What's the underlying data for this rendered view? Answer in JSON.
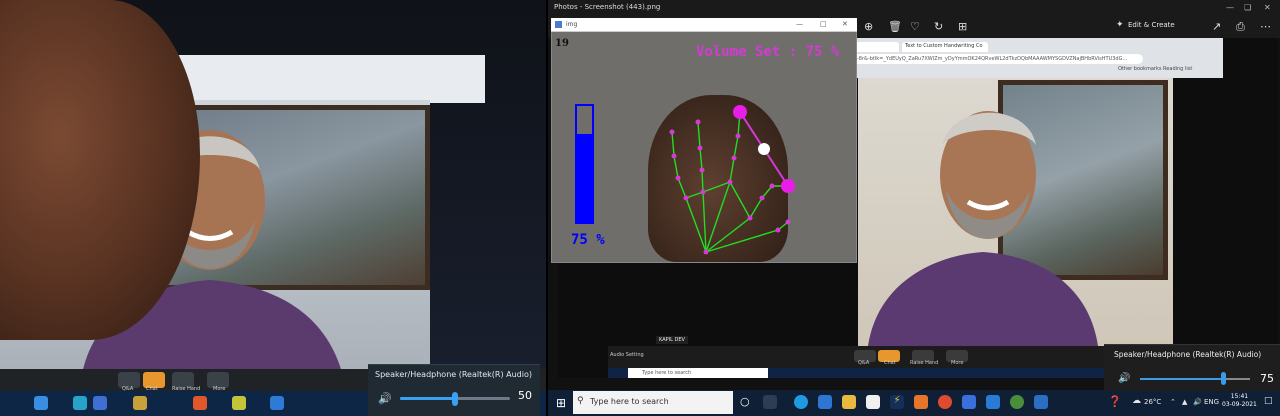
{
  "left": {
    "volume_popup": {
      "device": "Speaker/Headphone (Realtek(R) Audio)",
      "value": "50",
      "level_pct": 50
    },
    "zoom_buttons": [
      "Q&A",
      "Chat",
      "Raise Hand",
      "More"
    ]
  },
  "photos": {
    "title": "Photos - Screenshot (443).png",
    "edit_create": "Edit & Create",
    "inner_chrome": {
      "tab1": "Text to Custom Handwriting Co",
      "url": "-8r&-btlk=_YdEUyQ_ZaRu7XWlZm_yDyYmmOK24QRveWL2dTkzDQbMAAAWMYSGDVZNajBHbRVisHTU3dG...",
      "bookmarks": "Other bookmarks   Reading list"
    },
    "name_tag": "KAPIL DEV",
    "audio_setting": "Audio Setting",
    "inner_search": "Type here to search",
    "zoom_buttons": [
      "Q&A",
      "Chat",
      "Raise Hand",
      "More"
    ]
  },
  "img_window": {
    "title": "img",
    "fps": "19",
    "volume_set": "Volume Set : 75 %",
    "percent_text": "75 %",
    "bar_level_pct": 75
  },
  "taskbar": {
    "search_placeholder": "Type here to search",
    "temperature": "26°C",
    "language": "ENG",
    "time": "15:41",
    "date": "03-09-2021"
  },
  "volume_popup": {
    "device": "Speaker/Headphone (Realtek(R) Audio)",
    "value": "75",
    "level_pct": 75
  },
  "colors": {
    "accent": "#3a9be8",
    "cv_magenta": "#d43bd4",
    "cv_blue": "#0000ff",
    "taskbar": "#0e1f36"
  }
}
